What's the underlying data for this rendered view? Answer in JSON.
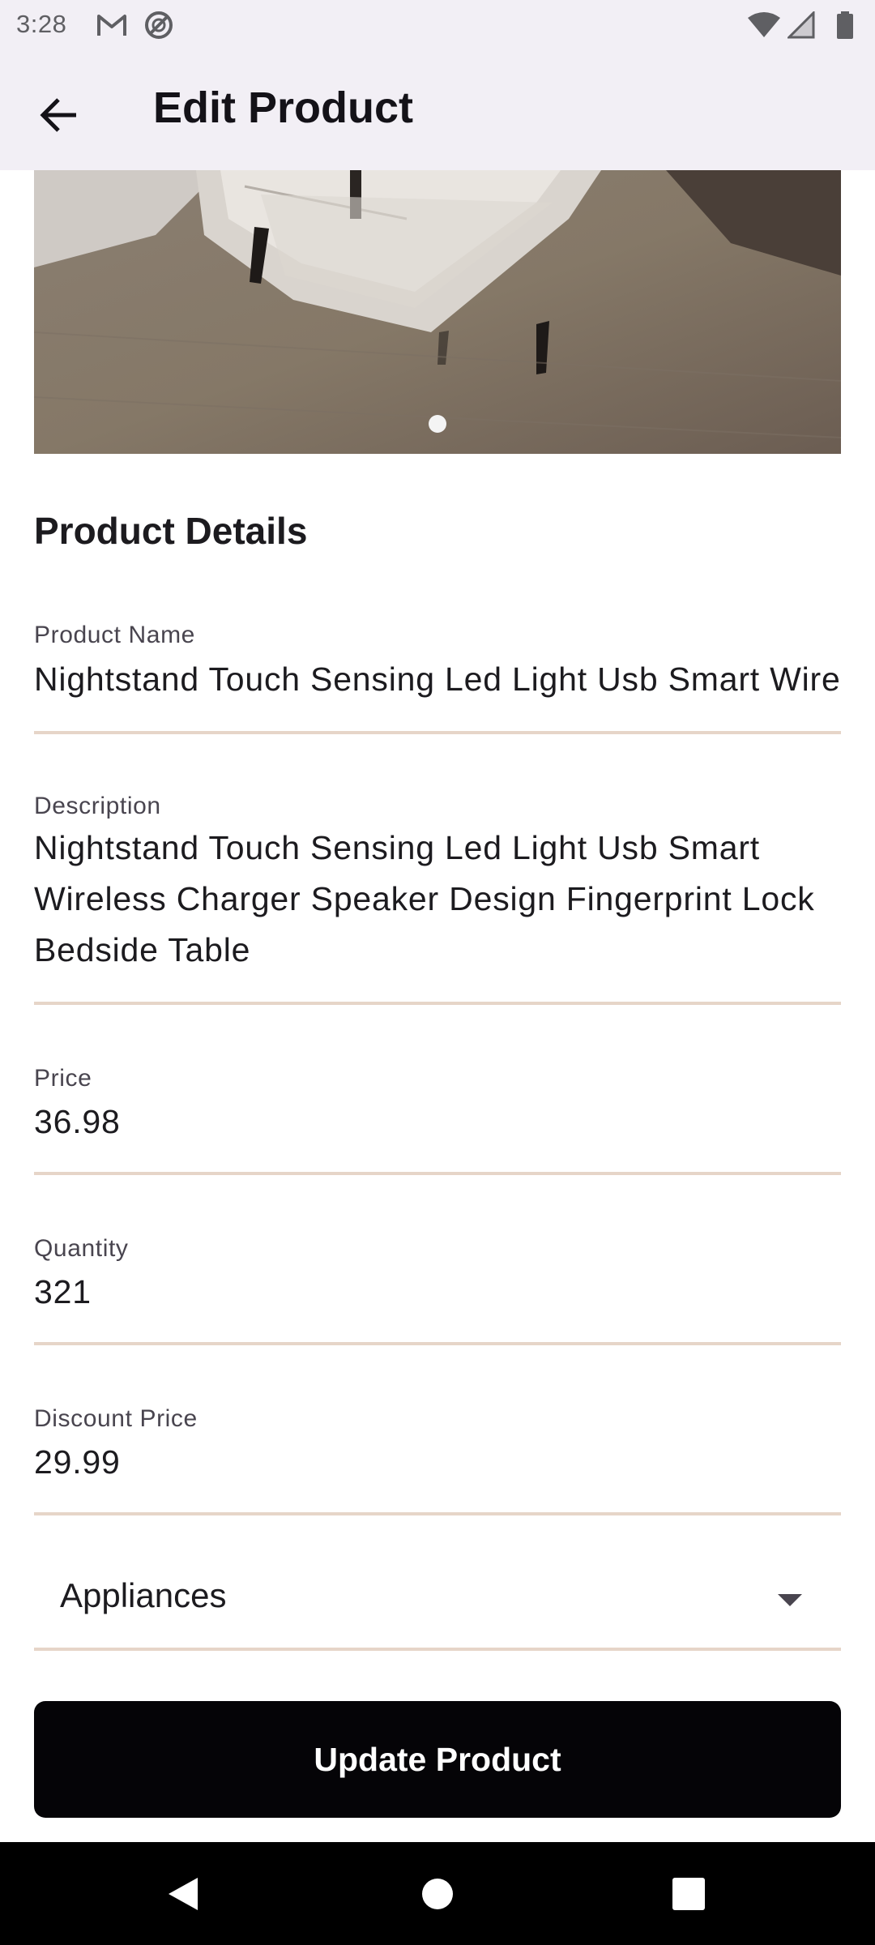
{
  "status_bar": {
    "time": "3:28",
    "left_icons": [
      "gmail-icon",
      "do-not-disturb-icon"
    ],
    "right_icons": [
      "wifi-icon",
      "cell-signal-icon",
      "battery-icon"
    ]
  },
  "app_bar": {
    "back_icon": "arrow-back-icon",
    "title": "Edit Product"
  },
  "carousel": {
    "page_count": 1,
    "active_index": 0
  },
  "section": {
    "title": "Product Details"
  },
  "fields": {
    "product_name": {
      "label": "Product Name",
      "value": "Nightstand Touch Sensing Led Light Usb Smart Wireless Charger Speaker Design Fingerprint Lock Bedside Table"
    },
    "description": {
      "label": "Description",
      "value": "Nightstand Touch Sensing Led Light Usb Smart Wireless Charger Speaker Design Fingerprint Lock Bedside Table"
    },
    "price": {
      "label": "Price",
      "value": "36.98"
    },
    "quantity": {
      "label": "Quantity",
      "value": "321"
    },
    "discount_price": {
      "label": "Discount Price",
      "value": "29.99"
    }
  },
  "category_dropdown": {
    "selected": "Appliances",
    "icon": "arrow-drop-down-icon"
  },
  "actions": {
    "update_label": "Update Product"
  },
  "colors": {
    "app_bar_bg": "#f2eff5",
    "field_underline": "#e6d5c8",
    "primary_button": "#050407",
    "nav_bar": "#000000"
  }
}
